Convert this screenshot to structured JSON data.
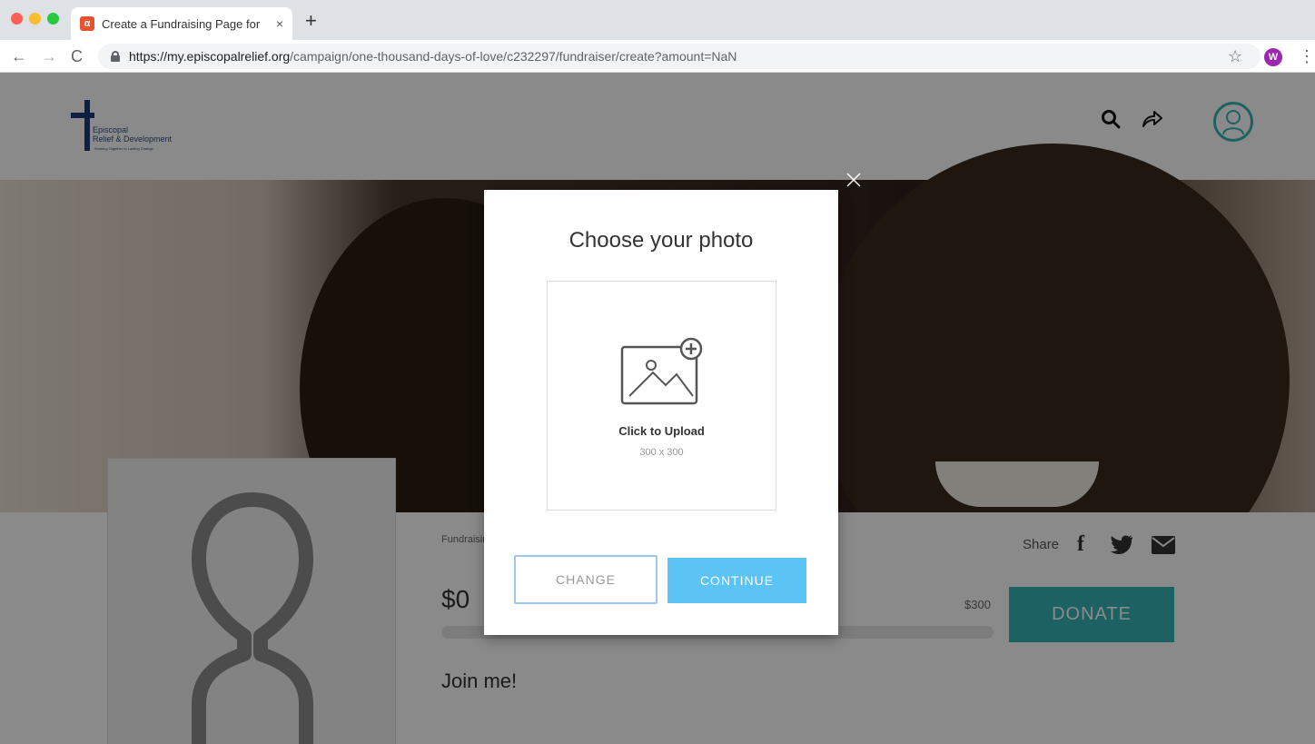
{
  "browser": {
    "tab_title": "Create a Fundraising Page for",
    "tab_close": "×",
    "new_tab": "+",
    "url_host": "https://my.episcopalrelief.org",
    "url_path": "/campaign/one-thousand-days-of-love/c232297/fundraiser/create?amount=NaN",
    "profile_initial": "W",
    "nav": {
      "back": "←",
      "forward": "→",
      "reload": "C"
    },
    "star": "☆",
    "menu": "⋮"
  },
  "site": {
    "logo_line1": "Episcopal",
    "logo_line2": "Relief & Development",
    "logo_tagline": "Working Together to Lasting Change",
    "icons": [
      "search-icon",
      "share-arrow-icon",
      "user-avatar-icon"
    ]
  },
  "campaign": {
    "fundraising_label": "Fundraising",
    "raised": "$0",
    "goal": "$300",
    "progress_fraction": 0.0,
    "heading": "Join me!",
    "share_label": "Share",
    "donate_label": "DONATE"
  },
  "modal": {
    "title": "Choose your photo",
    "upload_label": "Click to Upload",
    "upload_dimensions": "300 x 300",
    "change_label": "CHANGE",
    "continue_label": "CONTINUE"
  },
  "colors": {
    "accent_teal": "#36b6b6",
    "continue_blue": "#5cc4f5",
    "change_border": "#9fc8f0",
    "overlay": "rgba(0,0,0,0.46)"
  }
}
